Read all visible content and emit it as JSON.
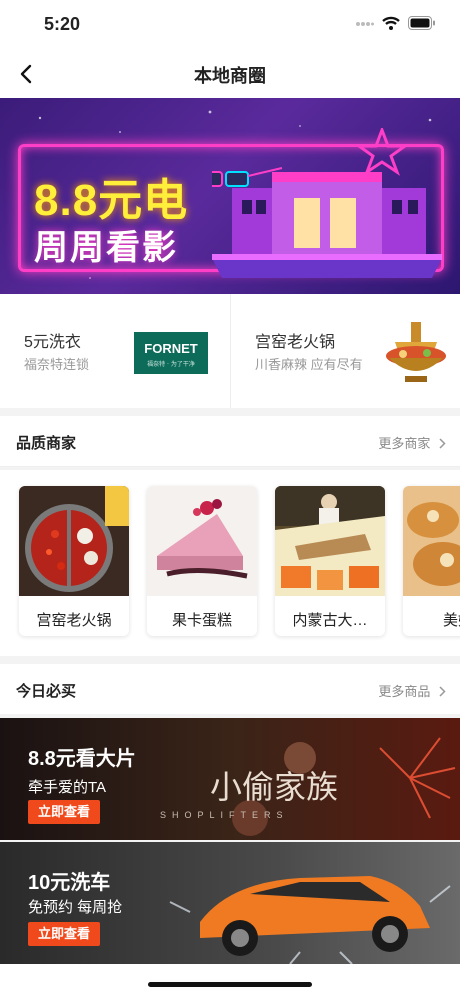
{
  "status": {
    "time": "5:20"
  },
  "nav": {
    "title": "本地商圈"
  },
  "banner": {
    "line1": "8.8元电",
    "line2": "周周看影"
  },
  "promos": [
    {
      "title": "5元洗衣",
      "subtitle": "福奈特连锁",
      "logo_text": "FORNET",
      "logo_sub": "福奈特 · 为了干净"
    },
    {
      "title": "宫窑老火锅",
      "subtitle": "川香麻辣 应有尽有"
    }
  ],
  "quality": {
    "title": "品质商家",
    "more": "更多商家",
    "shops": [
      {
        "name": "宫窑老火锅"
      },
      {
        "name": "果卡蛋糕"
      },
      {
        "name": "内蒙古大…"
      },
      {
        "name": "美妍"
      }
    ]
  },
  "today": {
    "title": "今日必买",
    "more": "更多商品",
    "deals": [
      {
        "title": "8.8元看大片",
        "subtitle": "牵手爱的TA",
        "button": "立即查看",
        "poster_title": "小偷家族",
        "poster_sub": "SHOPLIFTERS"
      },
      {
        "title": "10元洗车",
        "subtitle": "免预约 每周抢",
        "button": "立即查看"
      }
    ]
  },
  "colors": {
    "accent": "#f04a1c",
    "neon_pink": "#ff3ec8",
    "neon_yellow": "#ffef3a"
  }
}
